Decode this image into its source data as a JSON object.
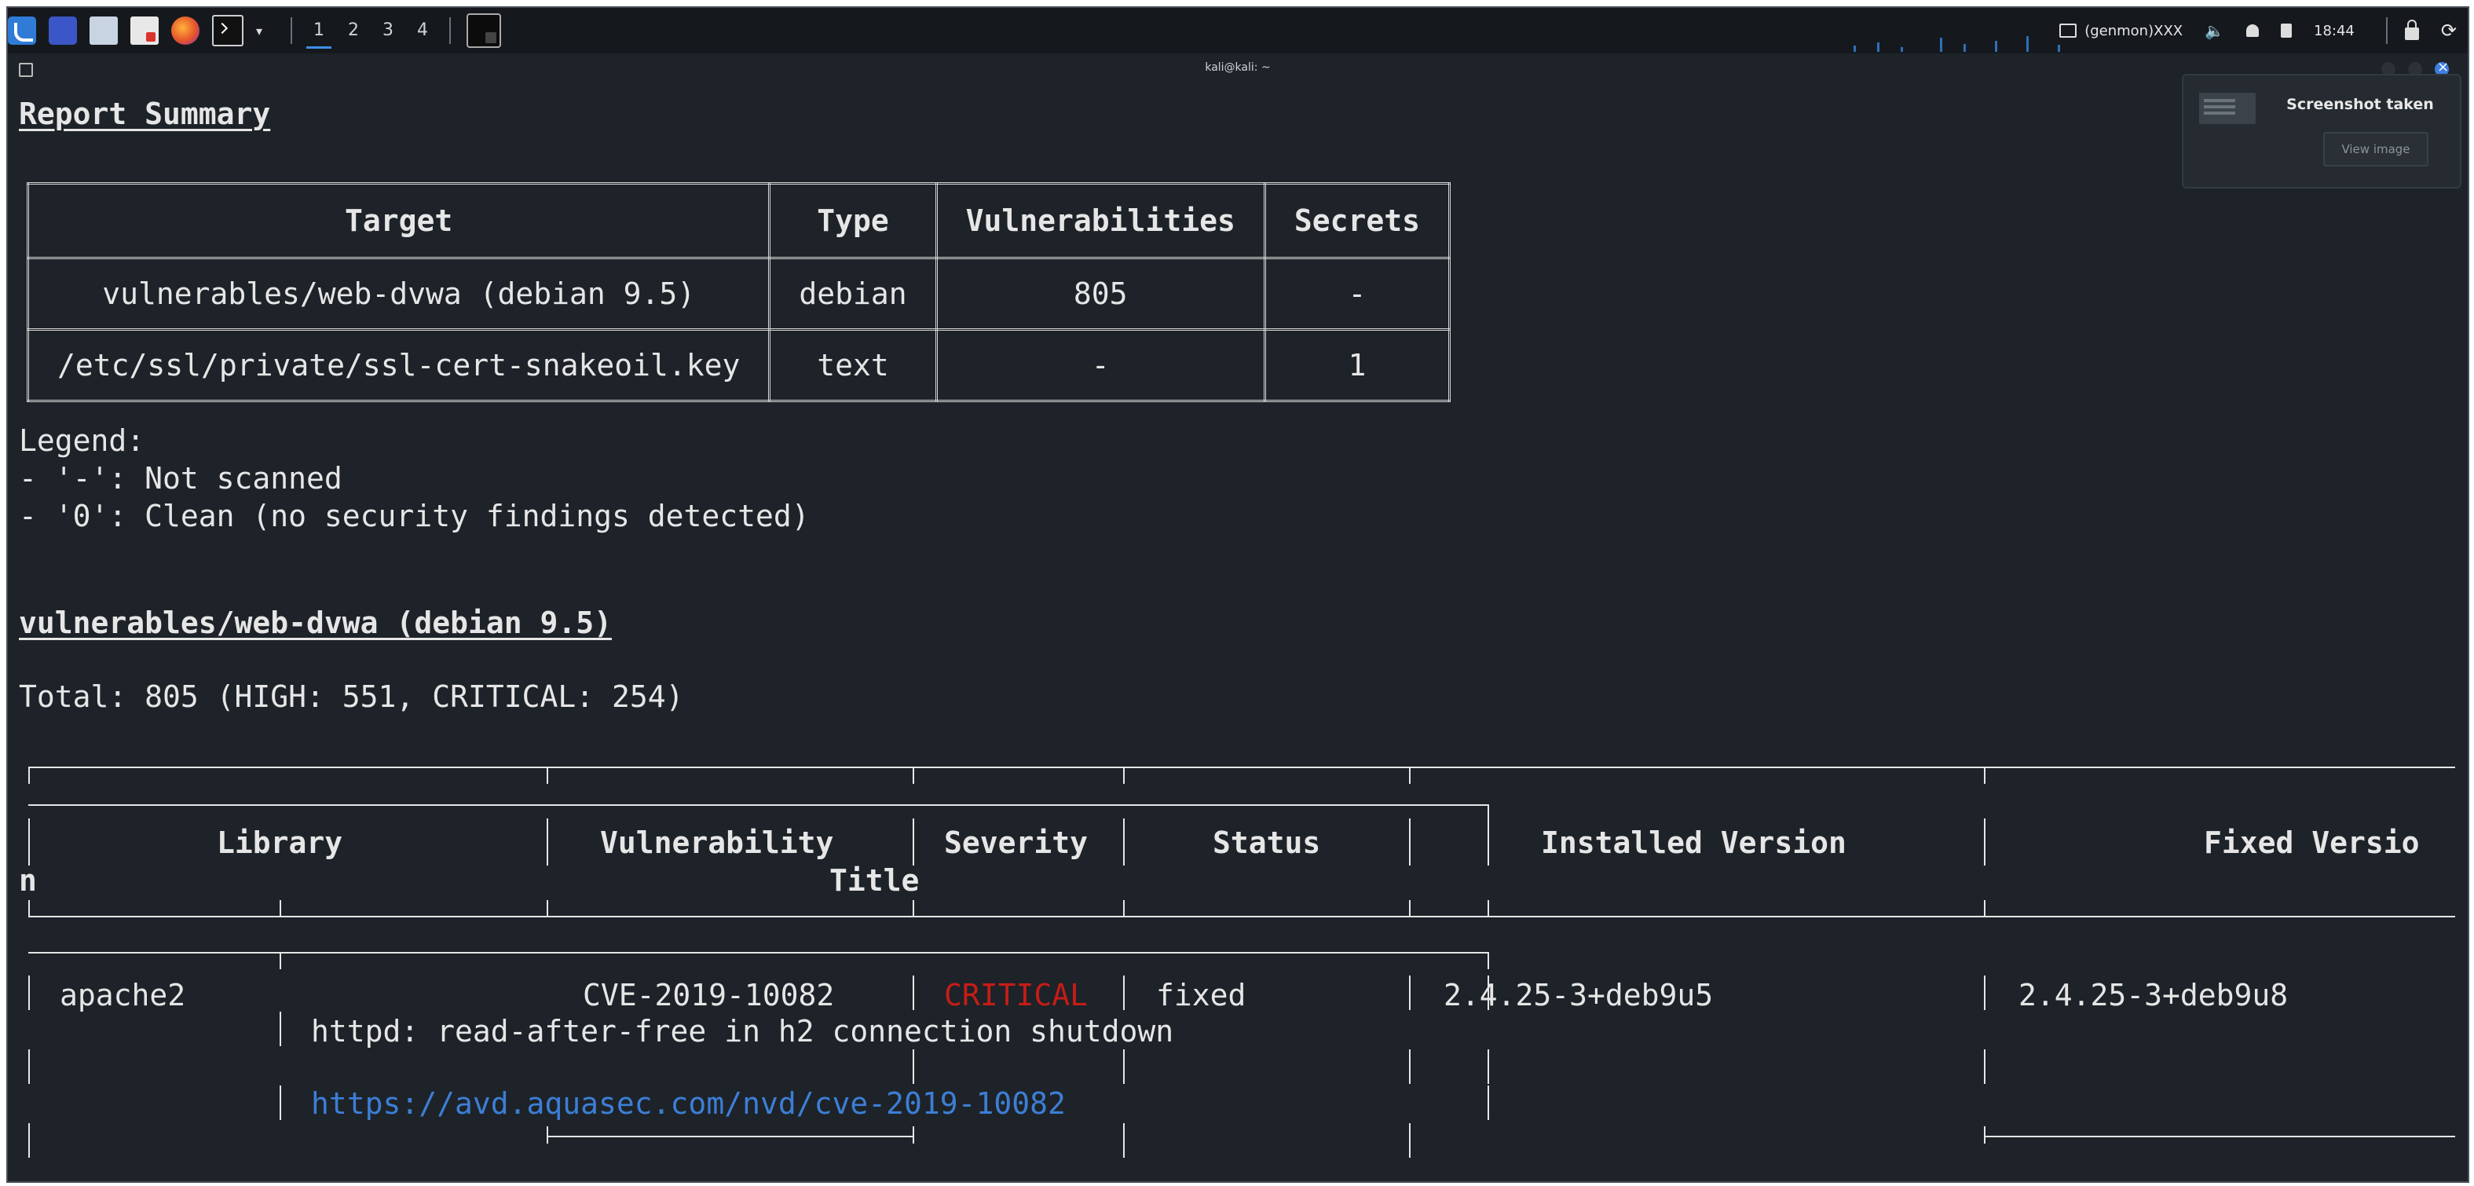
{
  "panel": {
    "workspaces": [
      "1",
      "2",
      "3",
      "4"
    ],
    "genmon": "(genmon)XXX",
    "clock": "18:44"
  },
  "window": {
    "title": "kali@kali: ~"
  },
  "notification": {
    "title": "Screenshot taken",
    "button": "View image"
  },
  "report": {
    "heading": "Report Summary",
    "headers": [
      "Target",
      "Type",
      "Vulnerabilities",
      "Secrets"
    ],
    "rows": [
      {
        "target": "vulnerables/web-dvwa (debian 9.5)",
        "type": "debian",
        "vulnerabilities": "805",
        "secrets": "-"
      },
      {
        "target": "/etc/ssl/private/ssl-cert-snakeoil.key",
        "type": "text",
        "vulnerabilities": "-",
        "secrets": "1"
      }
    ],
    "legend": {
      "title": "Legend:",
      "items": [
        "- '-': Not scanned",
        "- '0': Clean (no security findings detected)"
      ]
    }
  },
  "section": {
    "title": "vulnerables/web-dvwa (debian 9.5)",
    "total": "Total: 805 (HIGH: 551, CRITICAL: 254)"
  },
  "vuln_table": {
    "headers": {
      "library": "Library",
      "vulnerability": "Vulnerability",
      "severity": "Severity",
      "status": "Status",
      "installed": "Installed Version",
      "fixed_wrap": "Fixed Versio",
      "fixed_wrap_tail": "n",
      "title": "Title"
    },
    "rows": [
      {
        "library": "apache2",
        "vulnerability": "CVE-2019-10082",
        "severity": "CRITICAL",
        "status": "fixed",
        "installed": "2.4.25-3+deb9u5",
        "fixed": "2.4.25-3+deb9u8",
        "title": "httpd: read-after-free in h2 connection shutdown",
        "link": "https://avd.aquasec.com/nvd/cve-2019-10082"
      }
    ]
  },
  "colors": {
    "terminal_bg": "#1d2328",
    "text": "#e6e6e6",
    "critical": "#c61c17",
    "link": "#3d7ed6"
  }
}
